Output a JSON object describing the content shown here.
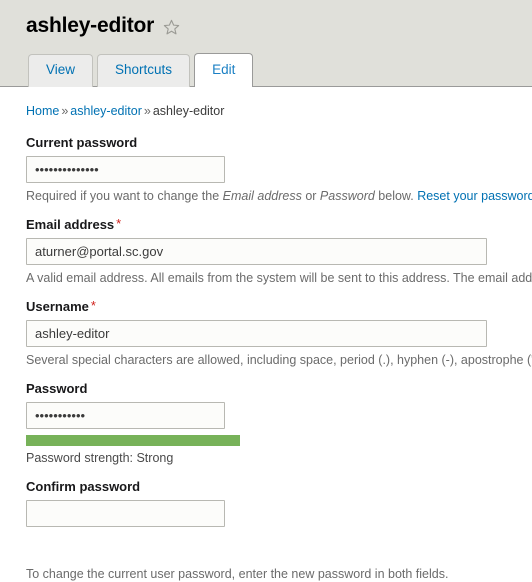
{
  "header": {
    "title": "ashley-editor",
    "star_icon": "star-outline-icon"
  },
  "tabs": [
    {
      "label": "View",
      "active": false
    },
    {
      "label": "Shortcuts",
      "active": false
    },
    {
      "label": "Edit",
      "active": true
    }
  ],
  "breadcrumb": {
    "home": "Home",
    "separator": "»",
    "parent": "ashley-editor",
    "current": "ashley-editor"
  },
  "form": {
    "current_password": {
      "label": "Current password",
      "value": "··············",
      "masked_value": "••••••••••••••",
      "required": false,
      "description_prefix": "Required if you want to change the ",
      "description_em1": "Email address",
      "description_mid": " or ",
      "description_em2": "Password",
      "description_suffix": " below. ",
      "description_link": "Reset your password."
    },
    "email_address": {
      "label": "Email address",
      "required": true,
      "value": "aturner@portal.sc.gov",
      "description": "A valid email address. All emails from the system will be sent to this address. The email addre"
    },
    "username": {
      "label": "Username",
      "required": true,
      "value": "ashley-editor",
      "description": "Several special characters are allowed, including space, period (.), hyphen (-), apostrophe ('), u"
    },
    "password": {
      "label": "Password",
      "required": false,
      "masked_value": "•••••••••••",
      "strength_text": "Password strength: Strong",
      "strength_percent": 100,
      "strength_color": "#77b259"
    },
    "confirm_password": {
      "label": "Confirm password",
      "required": false,
      "value": ""
    },
    "footer_note": "To change the current user password, enter the new password in both fields."
  },
  "colors": {
    "header_background": "#e0e0da",
    "link": "#0071b3",
    "required_marker": "#d0211c",
    "strength_strong": "#77b259",
    "page_background": "#ffffff"
  }
}
